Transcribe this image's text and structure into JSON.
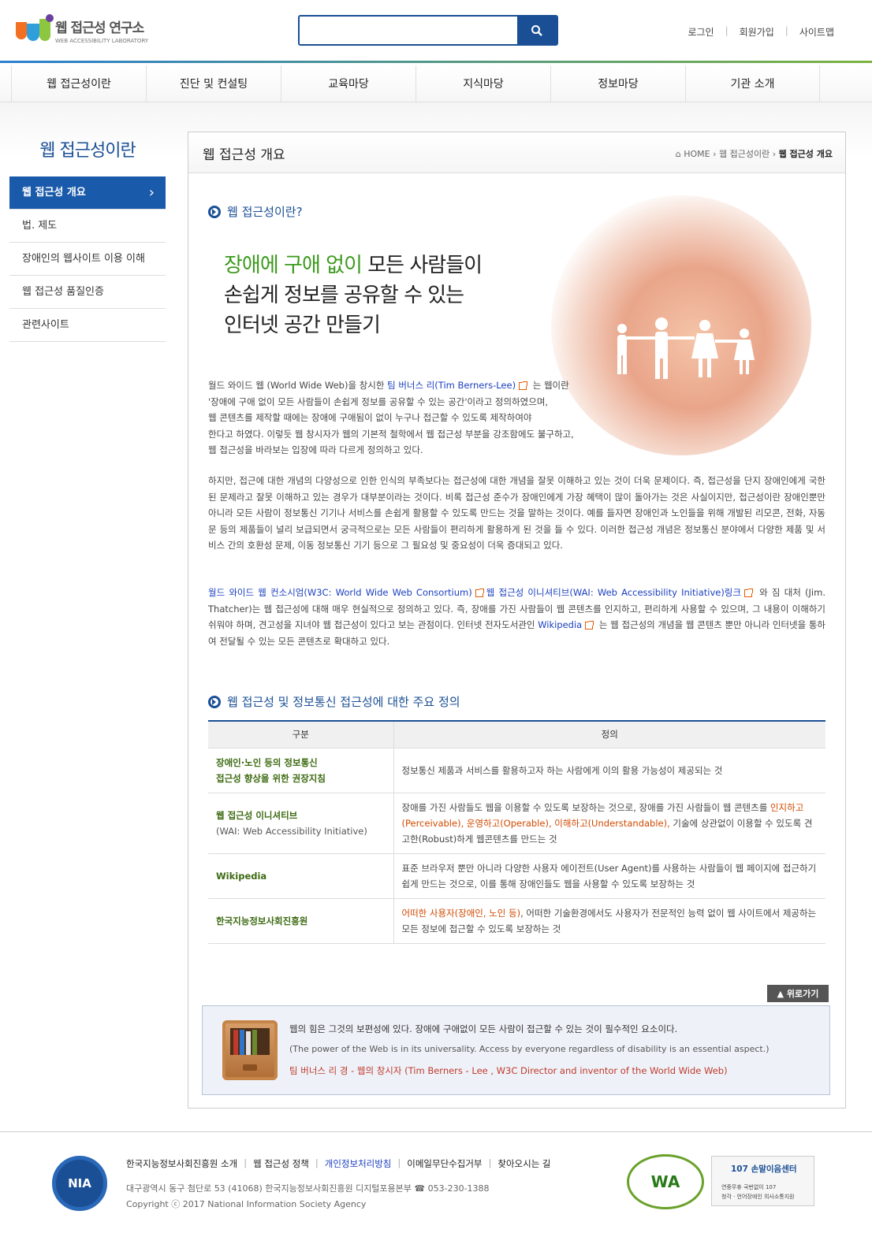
{
  "header": {
    "logo_title": "웹 접근성 연구소",
    "logo_sub": "WEB ACCESSIBILITY LABORATORY",
    "search_placeholder": "",
    "util": [
      "로그인",
      "회원가입",
      "사이트맵"
    ]
  },
  "gnb": [
    "웹 접근성이란",
    "진단 및 컨설팅",
    "교육마당",
    "지식마당",
    "정보마당",
    "기관 소개"
  ],
  "lnb": {
    "title": "웹 접근성이란",
    "items": [
      "웹 접근성 개요",
      "법. 제도",
      "장애인의 웹사이트 이용 이해",
      "웹 접근성 품질인증",
      "관련사이트"
    ]
  },
  "page": {
    "title": "웹 접근성 개요",
    "bread_home": "HOME",
    "bread_mid": "웹 접근성이란",
    "bread_cur": "웹 접근성 개요"
  },
  "section1": {
    "title": "웹 접근성이란?",
    "hero_green": "장애에 구애 없이",
    "hero_1": " 모든 사람들이",
    "hero_2": "손쉽게 정보를 공유할 수 있는",
    "hero_3": "인터넷 공간 만들기",
    "p1_a": "월드 와이드 웹 (World Wide Web)을 창시한 ",
    "p1_link": "팀 버너스 리(Tim Berners-Lee)",
    "p1_b": " 는 웹이란",
    "p1_l2": "'장애에 구애 없이 모든 사람들이 손쉽게 정보를 공유할 수 있는 공간'이라고 정의하였으며,",
    "p1_l3": "웹 콘텐츠를 제작할 때에는 장애에 구애됨이 없이 누구나 접근할 수 있도록 제작하여야",
    "p1_l4": "한다고 하였다. 이렇듯 웹 창시자가 웹의 기본적 철학에서 웹 접근성 부분을 강조함에도 불구하고,",
    "p1_l5": "웹 접근성을 바라보는 입장에 따라 다르게 정의하고 있다.",
    "p2": "하지만, 접근에 대한 개념의 다양성으로 인한 인식의 부족보다는 접근성에 대한 개념을 잘못 이해하고 있는 것이 더욱 문제이다. 즉, 접근성을 단지 장애인에게 국한된 문제라고 잘못 이해하고 있는 경우가 대부분이라는 것이다. 비록 접근성 준수가 장애인에게 가장 혜택이 많이 돌아가는 것은 사실이지만, 접근성이란 장애인뿐만 아니라 모든 사람이 정보통신 기기나 서비스를 손쉽게 활용할 수 있도록 만드는 것을 말하는 것이다. 예를 들자면 장애인과 노인들을 위해 개발된 리모콘, 전화, 자동문 등의 제품들이 널리 보급되면서 궁극적으로는 모든 사람들이 편리하게 활용하게 된 것을 들 수 있다. 이러한 접근성 개념은 정보통신 분야에서 다양한 제품 및 서비스 간의 호환성 문제, 이동 정보통신 기기 등으로 그 필요성 및 중요성이 더욱 증대되고 있다.",
    "p3_link1": "월드 와이드 웹 컨소시엄(W3C: World Wide Web Consortium)",
    "p3_link2": "웹 접근성 이니셔티브(WAI: Web Accessibility Initiative)링크",
    "p3_a": " 와 짐 대처 (Jim. Thatcher)는 웹 접근성에 대해 매우 현실적으로 정의하고 있다. 즉, 장애를 가진 사람들이 웹 콘텐츠를 인지하고, 편리하게 사용할 수 있으며, 그 내용이 이해하기 쉬워야 하며, 견고성을 지녀야 웹 접근성이 있다고 보는 관점이다. 인터넷 전자도서관인 ",
    "p3_link3": "Wikipedia",
    "p3_b": " 는 웹 접근성의 개념을 웹 콘텐츠 뿐만 아니라 인터넷을 통하여 전달될 수 있는 모든 콘텐츠로 확대하고 있다."
  },
  "section2": {
    "title": "웹 접근성 및 정보통신 접근성에 대한 주요 정의",
    "th1": "구분",
    "th2": "정의",
    "rows": [
      {
        "k1": "장애인·노인 등의 정보통신",
        "k2": "접근성 향상을 위한 권장지침",
        "v": "정보통신 제품과 서비스를 활용하고자 하는 사람에게 이의 활용 가능성이 제공되는 것"
      },
      {
        "k1": "웹 접근성 이니셔티브",
        "k2": "(WAI: Web Accessibility Initiative)",
        "v_a": "장애를 가진 사람들도 웹을 이용할 수 있도록 보장하는 것으로, 장애를 가진 사람들이 웹 콘텐츠를 ",
        "v_o": "인지하고(Perceivable), 운영하고(Operable), 이해하고(Understandable),",
        "v_b": " 기술에 상관없이 이용할 수 있도록 견고한(Robust)하게 웹콘텐츠를 만드는 것"
      },
      {
        "k1": "Wikipedia",
        "v": "표준 브라우저 뿐만 아니라 다양한 사용자 에이전트(User Agent)를 사용하는 사람들이 웹 페이지에 접근하기 쉽게 만드는 것으로, 이를 통해 장애인들도 웹을 사용할 수 있도록 보장하는 것"
      },
      {
        "k1": "한국지능정보사회진흥원",
        "v_o": "어떠한 사용자(장애인, 노인 등)",
        "v_b": ", 어떠한 기술환경에서도 사용자가 전문적인 능력 없이 웹 사이트에서 제공하는 모든 정보에 접근할 수 있도록 보장하는 것"
      }
    ]
  },
  "totop": "위로가기",
  "quote": {
    "ko": "웹의 힘은 그것의 보편성에 있다. 장애에 구애없이 모든 사람이 접근할 수 있는 것이 필수적인 요소이다.",
    "en": "(The power of the Web is in its universality. Access by everyone regardless of disability is an essential aspect.)",
    "author": "팀 버너스 리 경 - 웹의 창시자 (Tim Berners - Lee , W3C Director and inventor of the World Wide Web)"
  },
  "footer": {
    "nia": "NIA",
    "links": [
      "한국지능정보사회진흥원 소개",
      "웹 접근성 정책",
      "개인정보처리방침",
      "이메일무단수집거부",
      "찾아오시는 길"
    ],
    "address": "대구광역시 동구 첨단로 53 (41068) 한국지능정보사회진흥원 디지털포용본부 ☎ 053-230-1388",
    "copyright": "Copyright ⓒ 2017 National Information Society Agency",
    "wa": "WA",
    "center_title": "107 손말이음센터",
    "center_s1": "연중무휴 국번없이 107",
    "center_s2": "청각 · 언어장애인 의사소통지원"
  }
}
